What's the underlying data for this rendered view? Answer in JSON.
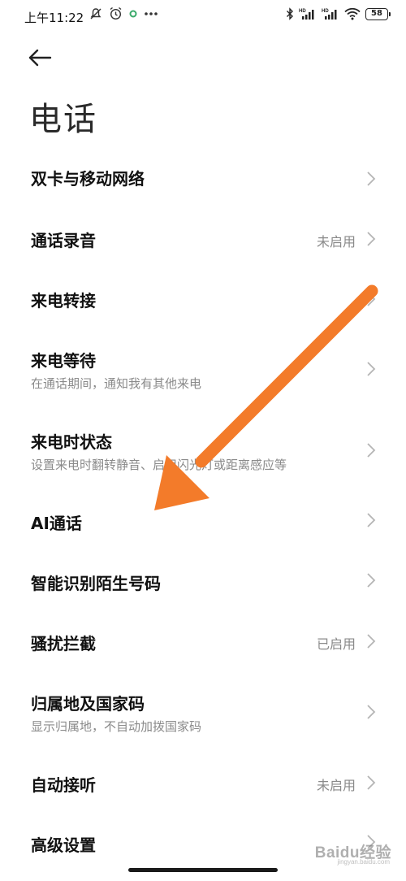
{
  "status_bar": {
    "time": "上午11:22",
    "left_icons": [
      "mute-icon",
      "alarm-icon",
      "notification-dot-icon",
      "more-dots-icon"
    ],
    "right_icons": [
      "bluetooth-icon",
      "signal-hd-1-icon",
      "signal-hd-2-icon",
      "wifi-icon"
    ],
    "signal_tag": "HD",
    "battery": "58"
  },
  "header": {
    "back_icon": "arrow-left-icon",
    "title": "电话"
  },
  "settings": [
    {
      "label": "双卡与移动网络",
      "sub": "",
      "value": ""
    },
    {
      "label": "通话录音",
      "sub": "",
      "value": "未启用"
    },
    {
      "label": "来电转接",
      "sub": "",
      "value": ""
    },
    {
      "label": "来电等待",
      "sub": "在通话期间，通知我有其他来电",
      "value": ""
    },
    {
      "label": "来电时状态",
      "sub": "设置来电时翻转静音、启用闪光灯或距离感应等",
      "value": ""
    },
    {
      "label": "AI通话",
      "sub": "",
      "value": ""
    },
    {
      "label": "智能识别陌生号码",
      "sub": "",
      "value": ""
    },
    {
      "label": "骚扰拦截",
      "sub": "",
      "value": "已启用"
    },
    {
      "label": "归属地及国家码",
      "sub": "显示归属地，不自动加拨国家码",
      "value": ""
    },
    {
      "label": "自动接听",
      "sub": "",
      "value": "未启用"
    },
    {
      "label": "高级设置",
      "sub": "",
      "value": ""
    }
  ],
  "overlay": {
    "arrow_color": "#F37B2A"
  },
  "watermark": {
    "text": "Baidu经验",
    "sub": "jingyan.baidu.com"
  }
}
